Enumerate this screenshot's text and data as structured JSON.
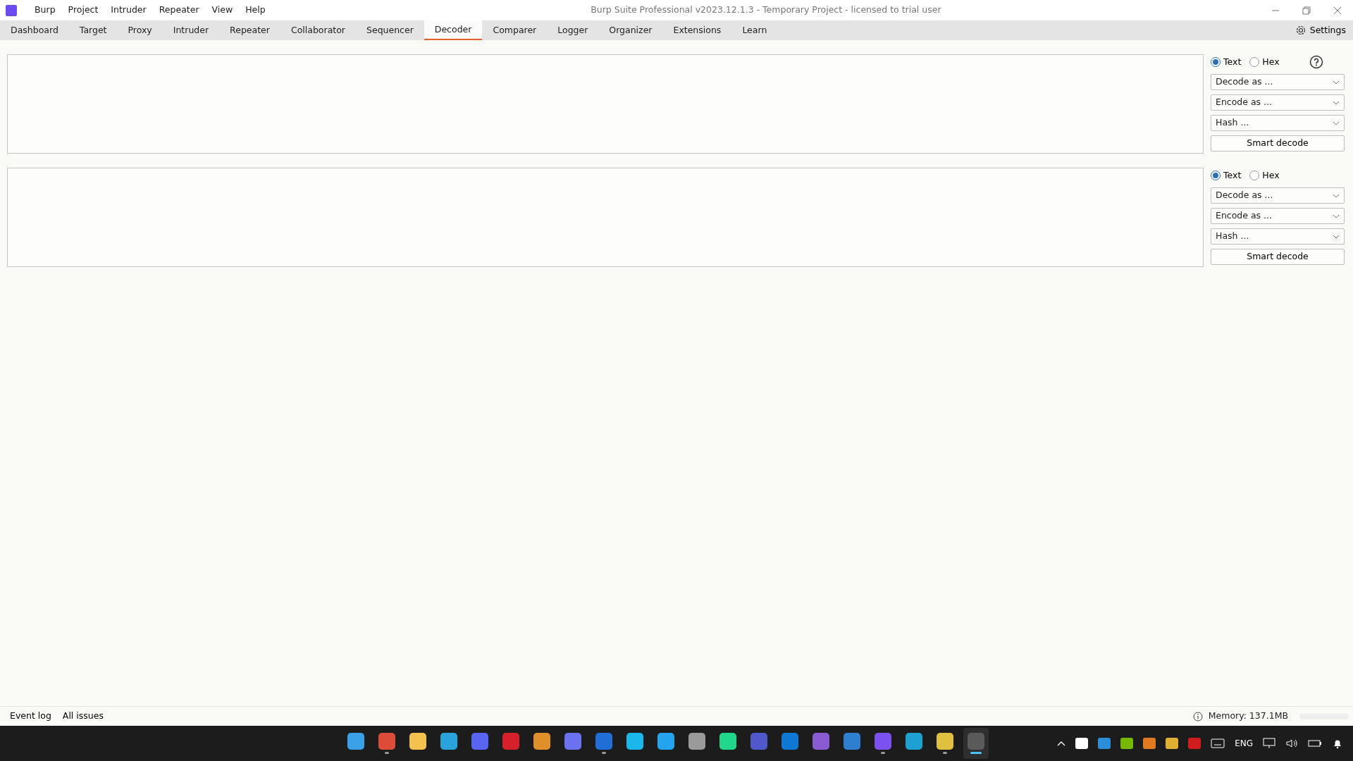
{
  "window": {
    "title": "Burp Suite Professional v2023.12.1.3 - Temporary Project - licensed to trial user"
  },
  "menu": [
    "Burp",
    "Project",
    "Intruder",
    "Repeater",
    "View",
    "Help"
  ],
  "tabs": [
    {
      "label": "Dashboard",
      "selected": false
    },
    {
      "label": "Target",
      "selected": false
    },
    {
      "label": "Proxy",
      "selected": false
    },
    {
      "label": "Intruder",
      "selected": false
    },
    {
      "label": "Repeater",
      "selected": false
    },
    {
      "label": "Collaborator",
      "selected": false
    },
    {
      "label": "Sequencer",
      "selected": false
    },
    {
      "label": "Decoder",
      "selected": true
    },
    {
      "label": "Comparer",
      "selected": false
    },
    {
      "label": "Logger",
      "selected": false
    },
    {
      "label": "Organizer",
      "selected": false
    },
    {
      "label": "Extensions",
      "selected": false
    },
    {
      "label": "Learn",
      "selected": false
    }
  ],
  "settings": {
    "label": "Settings"
  },
  "decoders": [
    {
      "radios": [
        {
          "label": "Text",
          "selected": true
        },
        {
          "label": "Hex",
          "selected": false
        }
      ],
      "help": true,
      "dropdowns": [
        "Decode as ...",
        "Encode as ...",
        "Hash ..."
      ],
      "button": "Smart decode"
    },
    {
      "radios": [
        {
          "label": "Text",
          "selected": true
        },
        {
          "label": "Hex",
          "selected": false
        }
      ],
      "help": false,
      "dropdowns": [
        "Decode as ...",
        "Encode as ...",
        "Hash ..."
      ],
      "button": "Smart decode"
    }
  ],
  "status_bar": {
    "tabs": [
      "Event log",
      "All issues"
    ],
    "memory": "Memory: 137.1MB"
  },
  "taskbar": {
    "apps": [
      {
        "color": "#3aa0e8",
        "running": false,
        "selected": false
      },
      {
        "color": "#dd4b39",
        "running": true,
        "selected": false
      },
      {
        "color": "#f2c14e",
        "running": false,
        "selected": false
      },
      {
        "color": "#2aa3dd",
        "running": false,
        "selected": false
      },
      {
        "color": "#5865f2",
        "running": false,
        "selected": false
      },
      {
        "color": "#d6212b",
        "running": false,
        "selected": false
      },
      {
        "color": "#e0902a",
        "running": false,
        "selected": false
      },
      {
        "color": "#6a72f0",
        "running": false,
        "selected": false
      },
      {
        "color": "#1f6fd6",
        "running": true,
        "selected": false
      },
      {
        "color": "#1ab7ea",
        "running": false,
        "selected": false
      },
      {
        "color": "#23a4ec",
        "running": false,
        "selected": false
      },
      {
        "color": "#9a9a9a",
        "running": false,
        "selected": false
      },
      {
        "color": "#21d789",
        "running": false,
        "selected": false
      },
      {
        "color": "#5059c9",
        "running": false,
        "selected": false
      },
      {
        "color": "#0f78d4",
        "running": false,
        "selected": false
      },
      {
        "color": "#8a5cd1",
        "running": false,
        "selected": false
      },
      {
        "color": "#2f7fd0",
        "running": false,
        "selected": false
      },
      {
        "color": "#7b52f0",
        "running": true,
        "selected": false
      },
      {
        "color": "#1ea0d0",
        "running": false,
        "selected": false
      },
      {
        "color": "#e0c040",
        "running": true,
        "selected": false
      },
      {
        "color": "#5a5a5a",
        "running": true,
        "selected": true
      }
    ],
    "tray": {
      "language": "ENG"
    }
  }
}
